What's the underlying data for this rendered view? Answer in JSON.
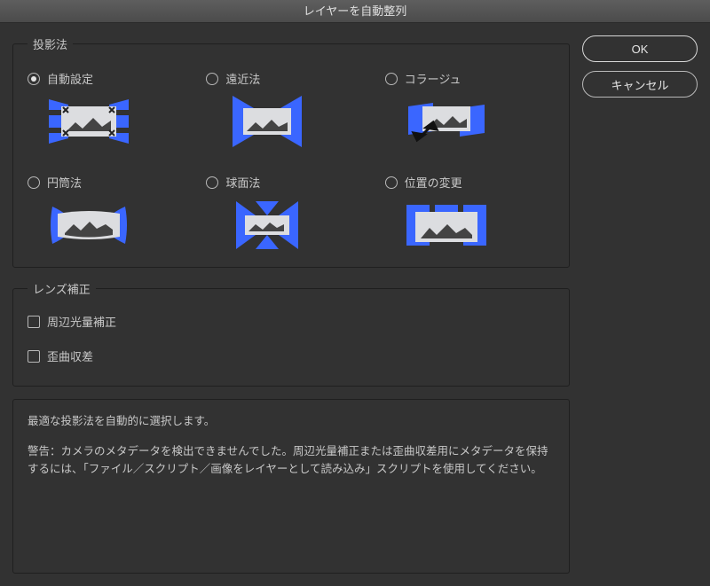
{
  "title": "レイヤーを自動整列",
  "buttons": {
    "ok": "OK",
    "cancel": "キャンセル"
  },
  "projection": {
    "legend": "投影法",
    "options": {
      "auto": {
        "label": "自動設定",
        "selected": true
      },
      "perspective": {
        "label": "遠近法",
        "selected": false
      },
      "collage": {
        "label": "コラージュ",
        "selected": false
      },
      "cylindrical": {
        "label": "円筒法",
        "selected": false
      },
      "spherical": {
        "label": "球面法",
        "selected": false
      },
      "reposition": {
        "label": "位置の変更",
        "selected": false
      }
    }
  },
  "lens": {
    "legend": "レンズ補正",
    "vignette": {
      "label": "周辺光量補正",
      "checked": false
    },
    "distortion": {
      "label": "歪曲収差",
      "checked": false
    }
  },
  "info": {
    "line1": "最適な投影法を自動的に選択します。",
    "line2": "警告：カメラのメタデータを検出できませんでした。周辺光量補正または歪曲収差用にメタデータを保持するには、「ファイル／スクリプト／画像をレイヤーとして読み込み」スクリプトを使用してください。"
  }
}
